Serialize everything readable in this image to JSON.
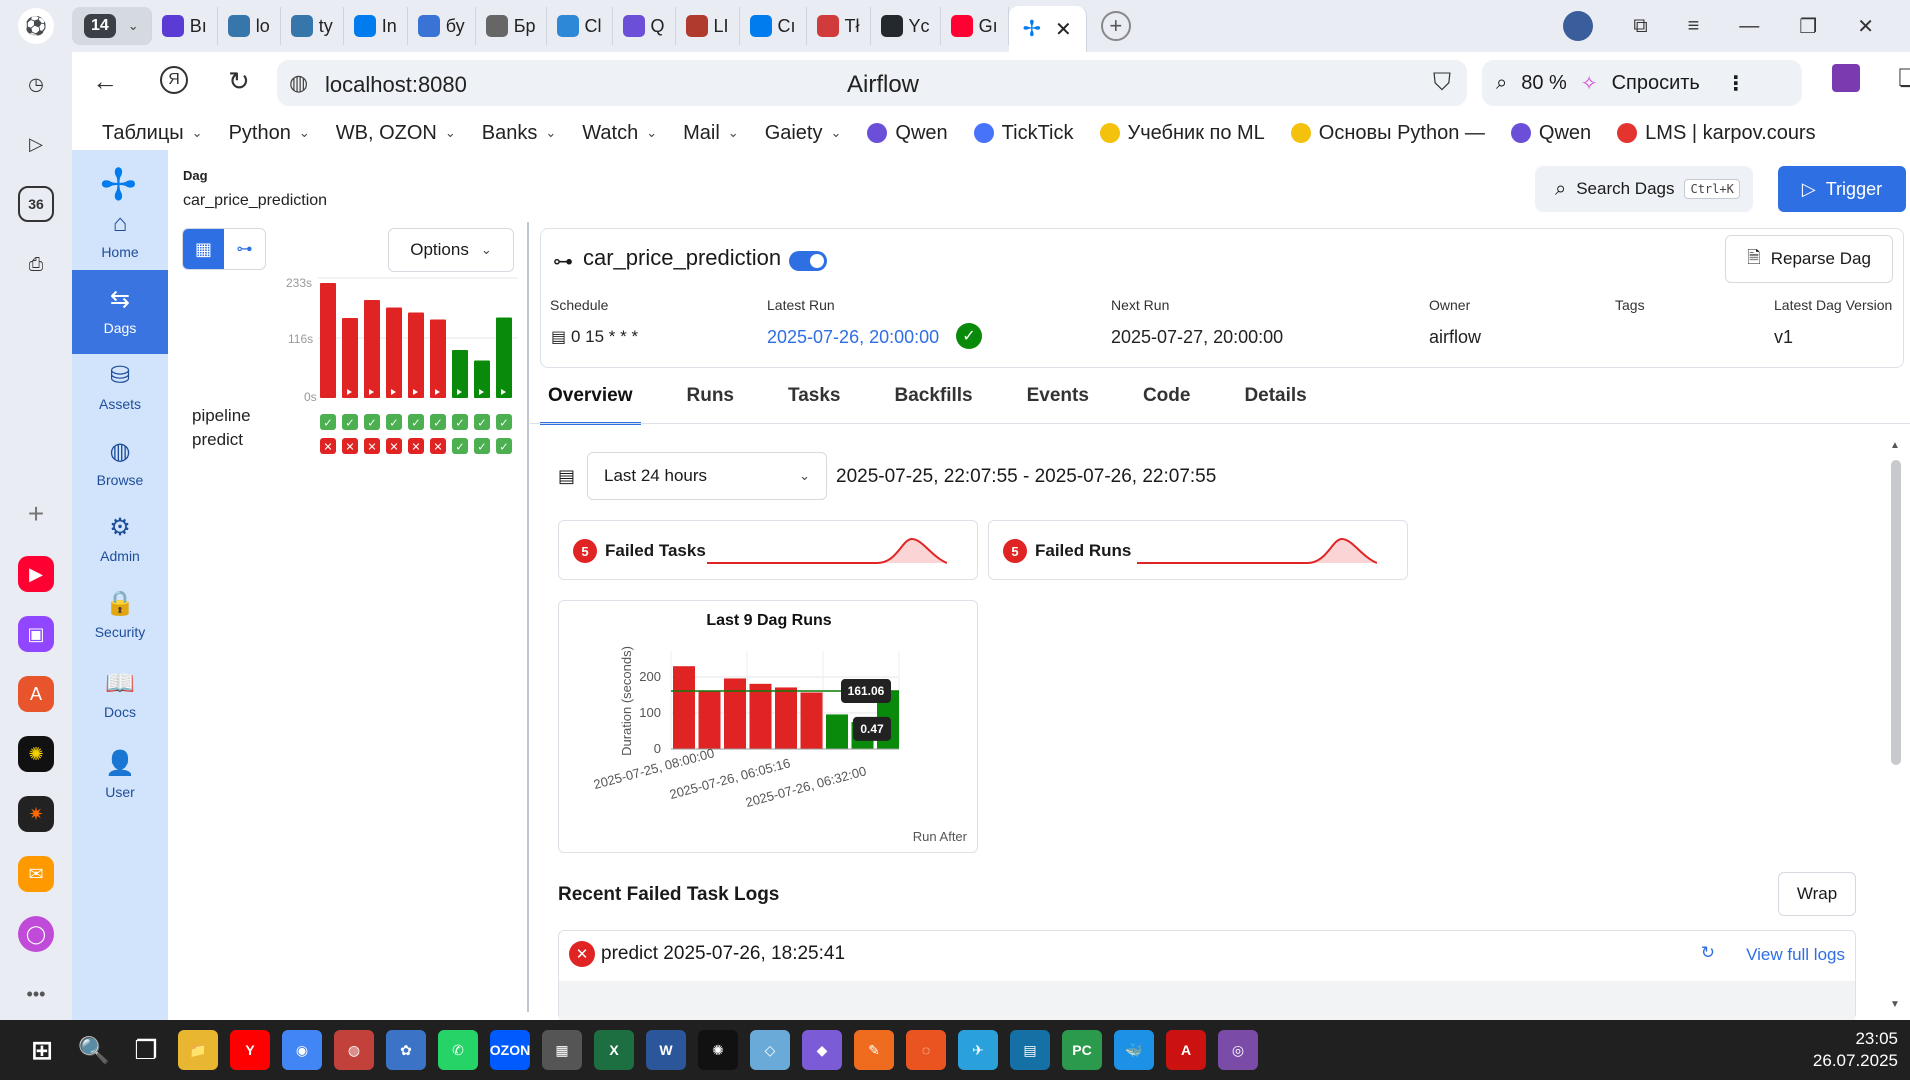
{
  "browser": {
    "tab_count": "14",
    "tabs": [
      {
        "label": "Вı",
        "color": "#5b3bd6"
      },
      {
        "label": "lo",
        "color": "#3776ab"
      },
      {
        "label": "ty",
        "color": "#3776ab"
      },
      {
        "label": "In",
        "color": "#017cee"
      },
      {
        "label": "бу",
        "color": "#3a73d6"
      },
      {
        "label": "Бр",
        "color": "#666666"
      },
      {
        "label": "Cl",
        "color": "#2e88d8"
      },
      {
        "label": "Q",
        "color": "#6b4fd8"
      },
      {
        "label": "LI",
        "color": "#b03a2e"
      },
      {
        "label": "Cı",
        "color": "#017cee"
      },
      {
        "label": "Tł",
        "color": "#d23b3b"
      },
      {
        "label": "Yc",
        "color": "#24292e"
      },
      {
        "label": "Gı",
        "color": "#ff0033"
      }
    ],
    "url": "localhost:8080",
    "page_title": "Airflow",
    "zoom": "80 %",
    "ask_label": "Спросить",
    "bookmarks": [
      {
        "label": "Таблицы",
        "folder": true
      },
      {
        "label": "Python",
        "folder": true
      },
      {
        "label": "WB, OZON",
        "folder": true
      },
      {
        "label": "Banks",
        "folder": true
      },
      {
        "label": "Watch",
        "folder": true
      },
      {
        "label": "Mail",
        "folder": true
      },
      {
        "label": "Gaiety",
        "folder": true
      },
      {
        "label": "Qwen",
        "folder": false,
        "color": "#6b4fd8"
      },
      {
        "label": "TickTick",
        "folder": false,
        "color": "#4772fa"
      },
      {
        "label": "Учебник по ML",
        "folder": false,
        "color": "#f4c20d"
      },
      {
        "label": "Основы Python —",
        "folder": false,
        "color": "#f4c20d"
      },
      {
        "label": "Qwen",
        "folder": false,
        "color": "#6b4fd8"
      },
      {
        "label": "LMS | karpov.cours",
        "folder": false,
        "color": "#e3342f"
      }
    ],
    "sidebar_badge": "36"
  },
  "nav": {
    "items": [
      {
        "label": "Home",
        "glyph": "⌂"
      },
      {
        "label": "Dags",
        "glyph": "⇆"
      },
      {
        "label": "Assets",
        "glyph": "⛁"
      },
      {
        "label": "Browse",
        "glyph": "◍"
      },
      {
        "label": "Admin",
        "glyph": "⚙"
      },
      {
        "label": "Security",
        "glyph": "🔒"
      },
      {
        "label": "Docs",
        "glyph": "📖"
      },
      {
        "label": "User",
        "glyph": "👤"
      }
    ]
  },
  "breadcrumb": {
    "label": "Dag",
    "value": "car_price_prediction"
  },
  "header": {
    "search_label": "Search Dags",
    "search_shortcut": "Ctrl+K",
    "trigger_label": "Trigger"
  },
  "grid": {
    "options_label": "Options",
    "axis_top": "233s",
    "axis_mid": "116s",
    "axis_bottom": "0s",
    "runs": [
      {
        "duration": 230,
        "state": "failed"
      },
      {
        "duration": 160,
        "state": "failed"
      },
      {
        "duration": 196,
        "state": "failed"
      },
      {
        "duration": 181,
        "state": "failed"
      },
      {
        "duration": 171,
        "state": "failed"
      },
      {
        "duration": 157,
        "state": "failed"
      },
      {
        "duration": 96,
        "state": "success"
      },
      {
        "duration": 75,
        "state": "success"
      },
      {
        "duration": 161,
        "state": "success"
      }
    ],
    "tasks": [
      {
        "name": "pipeline",
        "states": [
          "success",
          "success",
          "success",
          "success",
          "success",
          "success",
          "success",
          "success",
          "success"
        ]
      },
      {
        "name": "predict",
        "states": [
          "failed",
          "failed",
          "failed",
          "failed",
          "failed",
          "failed",
          "success",
          "success",
          "success"
        ]
      }
    ]
  },
  "dag": {
    "title": "car_price_prediction",
    "paused": false,
    "reparse_label": "Reparse Dag",
    "meta": [
      {
        "label": "Schedule",
        "value": "0 15 * * *"
      },
      {
        "label": "Latest Run",
        "value": "2025-07-26, 20:00:00"
      },
      {
        "label": "Next Run",
        "value": "2025-07-27, 20:00:00"
      },
      {
        "label": "Owner",
        "value": "airflow"
      },
      {
        "label": "Tags",
        "value": ""
      },
      {
        "label": "Latest Dag Version",
        "value": "v1"
      }
    ]
  },
  "tabs": [
    "Overview",
    "Runs",
    "Tasks",
    "Backfills",
    "Events",
    "Code",
    "Details"
  ],
  "overview": {
    "range": "Last 24 hours",
    "range_text": "2025-07-25, 22:07:55 - 2025-07-26, 22:07:55",
    "failed_tasks": {
      "count": "5",
      "label": "Failed Tasks"
    },
    "failed_runs": {
      "count": "5",
      "label": "Failed Runs"
    }
  },
  "chart_data": {
    "type": "bar",
    "title": "Last 9 Dag Runs",
    "ylabel": "Duration (seconds)",
    "xlabel": "Run After",
    "ylim": [
      0,
      250
    ],
    "yticks": [
      "0",
      "100",
      "200"
    ],
    "xtick_labels": [
      "2025-07-25, 08:00:00",
      "2025-07-26, 06:05:16",
      "2025-07-26, 06:32:00"
    ],
    "values": [
      230,
      160,
      196,
      181,
      171,
      157,
      96,
      75,
      161
    ],
    "states": [
      "failed",
      "failed",
      "failed",
      "failed",
      "failed",
      "failed",
      "success",
      "success",
      "success"
    ],
    "annotations": [
      {
        "label": "161.06",
        "value": 161.06
      },
      {
        "label": "0.47",
        "value": 0.47
      }
    ],
    "colors": {
      "failed": "#e02424",
      "success": "#0a8a0a",
      "line": "#0a7a0a"
    }
  },
  "logs": {
    "title": "Recent Failed Task Logs",
    "wrap_label": "Wrap",
    "entry": "predict 2025-07-26, 18:25:41",
    "view_full": "View full logs"
  },
  "taskbar": {
    "apps": [
      "⊞",
      "🔍",
      "❐",
      "📁",
      "Y",
      "◉",
      "◍",
      "✿",
      "✆",
      "OZON",
      "▦",
      "X",
      "W",
      "✺",
      "◇",
      "◆",
      "✎",
      "◌",
      "✈",
      "▤",
      "PC",
      "🐳",
      "A",
      "◎"
    ],
    "time": "23:05",
    "date": "26.07.2025"
  }
}
